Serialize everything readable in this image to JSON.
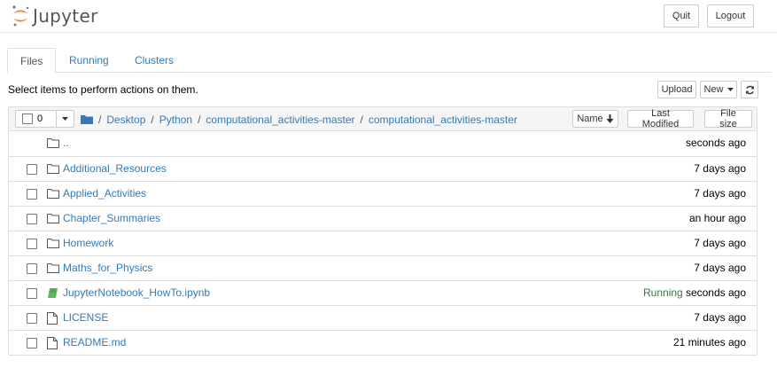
{
  "header": {
    "logo_text": "Jupyter",
    "quit_label": "Quit",
    "logout_label": "Logout"
  },
  "tabs": [
    {
      "label": "Files",
      "active": true
    },
    {
      "label": "Running",
      "active": false
    },
    {
      "label": "Clusters",
      "active": false
    }
  ],
  "toolbar": {
    "instructions": "Select items to perform actions on them.",
    "upload_label": "Upload",
    "new_label": "New",
    "refresh_icon": "refresh-icon"
  },
  "list_header": {
    "selected_count": "0",
    "breadcrumbs": [
      "Desktop",
      "Python",
      "computational_activities-master",
      "computational_activities-master"
    ],
    "separator": "/",
    "sort_name_label": "Name",
    "sort_modified_label": "Last Modified",
    "sort_size_label": "File size"
  },
  "items": [
    {
      "name": "..",
      "type": "folder",
      "modified": "seconds ago",
      "status": ""
    },
    {
      "name": "Additional_Resources",
      "type": "folder",
      "modified": "7 days ago",
      "status": ""
    },
    {
      "name": "Applied_Activities",
      "type": "folder",
      "modified": "7 days ago",
      "status": ""
    },
    {
      "name": "Chapter_Summaries",
      "type": "folder",
      "modified": "an hour ago",
      "status": ""
    },
    {
      "name": "Homework",
      "type": "folder",
      "modified": "7 days ago",
      "status": ""
    },
    {
      "name": "Maths_for_Physics",
      "type": "folder",
      "modified": "7 days ago",
      "status": ""
    },
    {
      "name": "JupyterNotebook_HowTo.ipynb",
      "type": "notebook",
      "modified": "seconds ago",
      "status": "Running"
    },
    {
      "name": "LICENSE",
      "type": "file",
      "modified": "7 days ago",
      "status": ""
    },
    {
      "name": "README.md",
      "type": "file",
      "modified": "21 minutes ago",
      "status": ""
    }
  ],
  "colors": {
    "link": "#337ab7",
    "running": "#3c763d",
    "logo_orange": "#f37726",
    "notebook_green": "#5cb85c"
  }
}
